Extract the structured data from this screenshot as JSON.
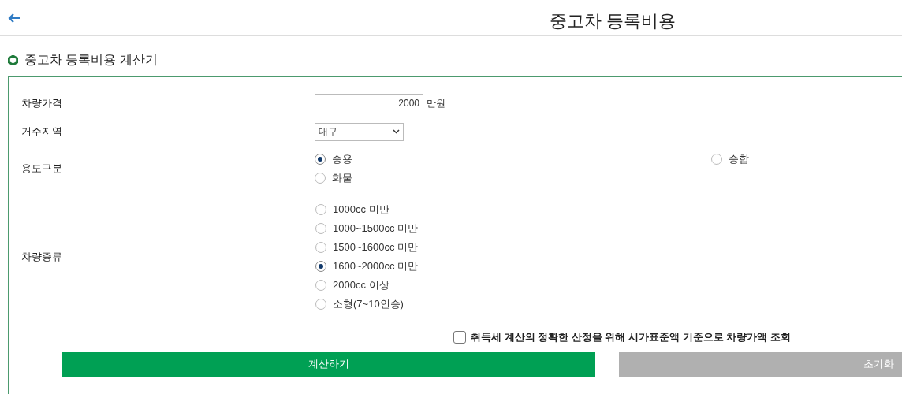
{
  "header": {
    "title": "중고차 등록비용"
  },
  "section": {
    "title": "중고차 등록비용 계산기"
  },
  "form": {
    "price": {
      "label": "차량가격",
      "value": "2000",
      "unit": "만원"
    },
    "region": {
      "label": "거주지역",
      "value": "대구"
    },
    "usage": {
      "label": "용도구분",
      "options": [
        {
          "label": "승용",
          "selected": true
        },
        {
          "label": "승합",
          "selected": false
        },
        {
          "label": "화물",
          "selected": false
        }
      ]
    },
    "vehicle_type": {
      "label": "차량종류",
      "options": [
        {
          "label": "1000cc 미만",
          "selected": false
        },
        {
          "label": "1000~1500cc 미만",
          "selected": false
        },
        {
          "label": "1500~1600cc 미만",
          "selected": false
        },
        {
          "label": "1600~2000cc 미만",
          "selected": true
        },
        {
          "label": "2000cc 이상",
          "selected": false
        },
        {
          "label": "소형(7~10인승)",
          "selected": false
        }
      ]
    },
    "standard_price_check": {
      "label": "취득세 계산의 정확한 산정을 위해 시가표준액 기준으로 차량가액 조회",
      "checked": false
    }
  },
  "buttons": [
    {
      "kind": "primary",
      "label": "계산하기"
    },
    {
      "kind": "secondary",
      "label": "초기화"
    }
  ]
}
